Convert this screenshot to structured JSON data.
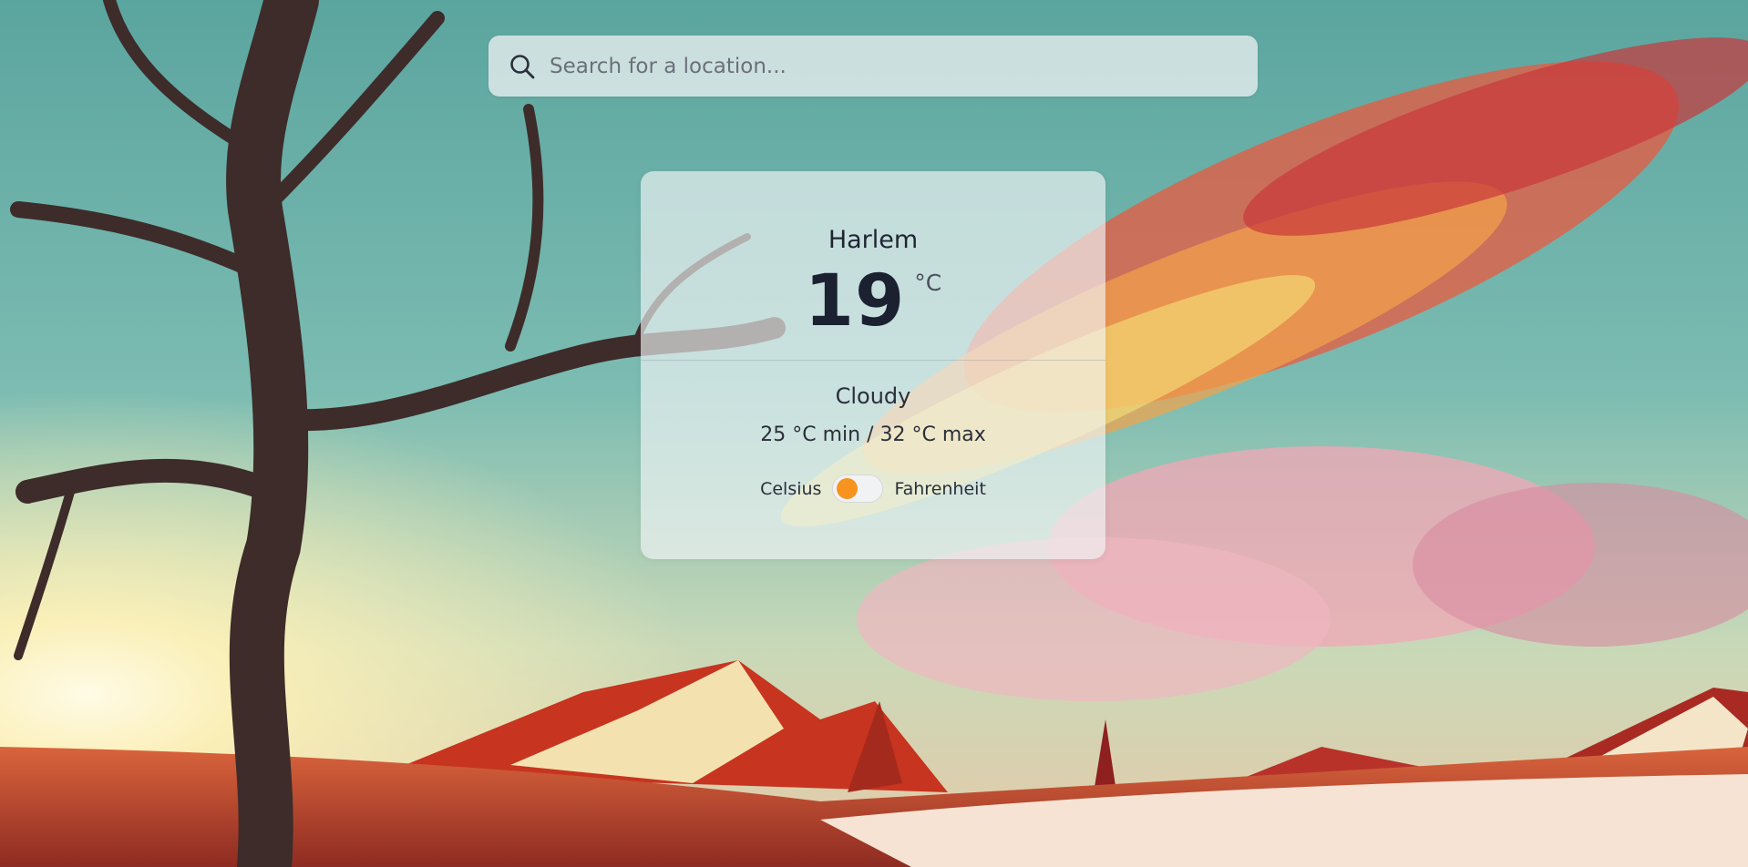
{
  "search": {
    "placeholder": "Search for a location..."
  },
  "weather": {
    "city": "Harlem",
    "temperature": "19",
    "unit": "°C",
    "condition": "Cloudy",
    "min_max": "25 °C min / 32 °C max"
  },
  "unit_toggle": {
    "left_label": "Celsius",
    "right_label": "Fahrenheit",
    "state": "Celsius",
    "accent": "#f7931e"
  },
  "icons": {
    "search": "search-icon"
  }
}
